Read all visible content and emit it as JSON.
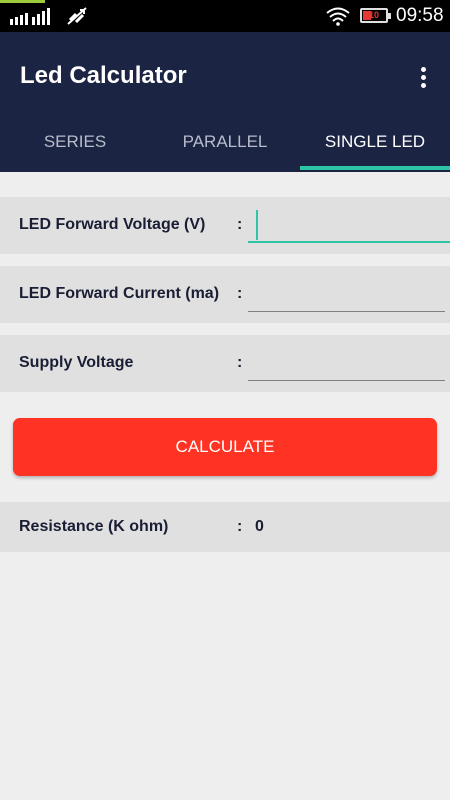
{
  "status_bar": {
    "time": "09:58",
    "battery_level": "10",
    "icons": [
      "signal-icon",
      "sync-disabled-icon",
      "wifi-icon",
      "battery-icon"
    ]
  },
  "app": {
    "title": "Led Calculator",
    "menu_icon": "overflow-menu-icon"
  },
  "tabs": [
    {
      "label": "SERIES",
      "active": false
    },
    {
      "label": "PARALLEL",
      "active": false
    },
    {
      "label": "SINGLE LED",
      "active": true
    }
  ],
  "form": {
    "fields": [
      {
        "label": "LED Forward Voltage (V)",
        "separator": ":",
        "value": "",
        "focused": true
      },
      {
        "label": "LED Forward Current (ma)",
        "separator": ":",
        "value": "",
        "focused": false
      },
      {
        "label": "Supply Voltage",
        "separator": ":",
        "value": "",
        "focused": false
      }
    ],
    "calculate_label": "CALCULATE",
    "result": {
      "label": "Resistance  (K ohm)",
      "separator": ":",
      "value": "0"
    }
  },
  "colors": {
    "app_bar": "#1c2444",
    "accent": "#2ec4a6",
    "button": "#fe3323",
    "background": "#eeeeee",
    "row_background": "#e0e0e0"
  }
}
